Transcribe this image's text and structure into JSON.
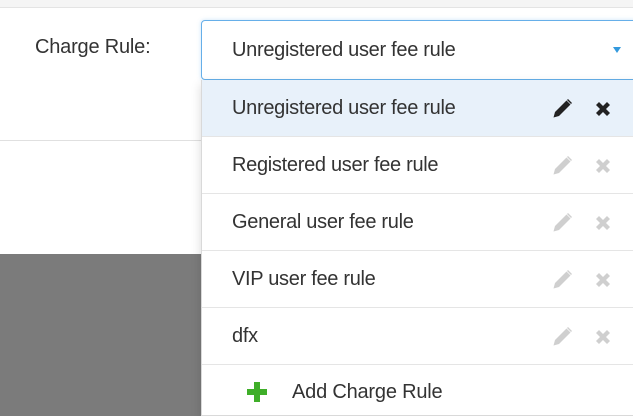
{
  "form": {
    "label": "Charge Rule:",
    "selected_value": "Unregistered user fee rule"
  },
  "dropdown": {
    "options": [
      {
        "label": "Unregistered user fee rule",
        "active": true
      },
      {
        "label": "Registered user fee rule",
        "active": false
      },
      {
        "label": "General user fee rule",
        "active": false
      },
      {
        "label": "VIP user fee rule",
        "active": false
      },
      {
        "label": "dfx",
        "active": false
      }
    ],
    "add_label": "Add Charge Rule"
  },
  "icons": {
    "edit": "pencil-icon",
    "delete": "close-icon",
    "add": "plus-icon",
    "caret": "caret-down-icon"
  },
  "colors": {
    "focus_border": "#66afe9",
    "caret": "#3399dd",
    "active_option_bg": "#e8f1fa",
    "active_icon": "#222222",
    "inactive_icon": "#cfcfcf",
    "add_icon": "#3fae29"
  }
}
